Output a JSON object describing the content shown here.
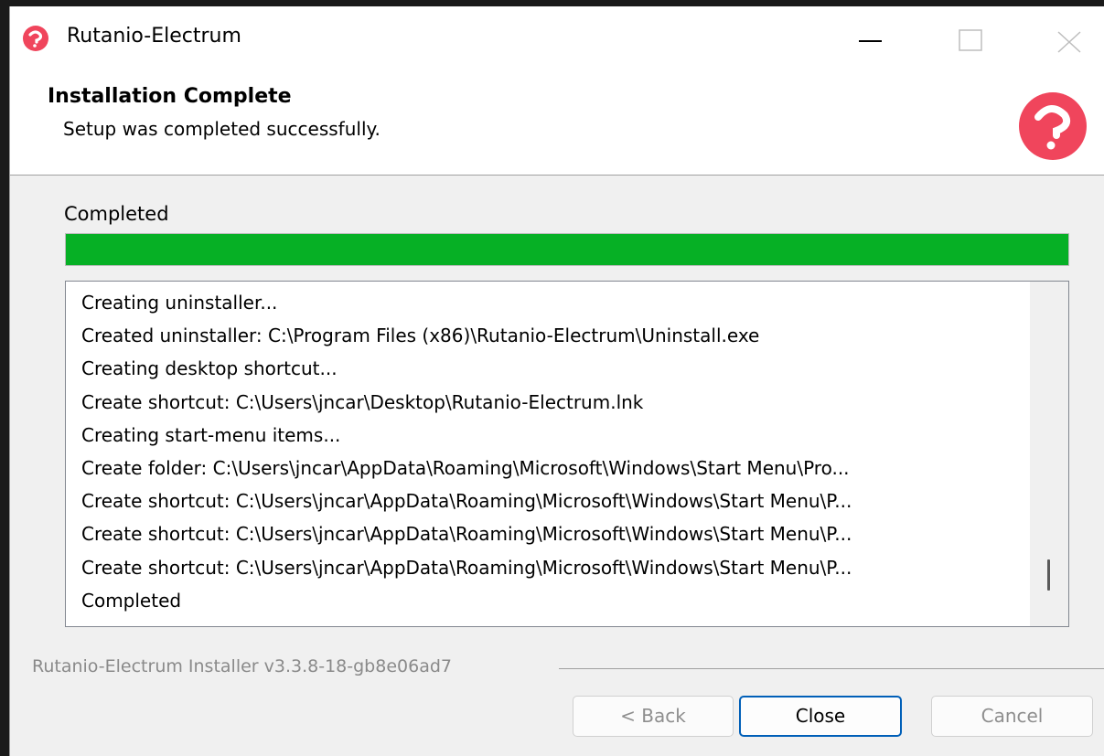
{
  "window": {
    "title": "Rutanio-Electrum",
    "controls": {
      "minimize": "minimize-icon",
      "maximize": "maximize-icon",
      "close": "close-icon"
    }
  },
  "header": {
    "title": "Installation Complete",
    "subtitle": "Setup was completed successfully.",
    "logo": "rutanio-logo-icon"
  },
  "status": {
    "label": "Completed",
    "progress": 1.0
  },
  "log": {
    "lines": [
      "Creating uninstaller...",
      "Created uninstaller: C:\\Program Files (x86)\\Rutanio-Electrum\\Uninstall.exe",
      "Creating desktop shortcut...",
      "Create shortcut: C:\\Users\\jncar\\Desktop\\Rutanio-Electrum.lnk",
      "Creating start-menu items...",
      "Create folder: C:\\Users\\jncar\\AppData\\Roaming\\Microsoft\\Windows\\Start Menu\\Pro...",
      "Create shortcut: C:\\Users\\jncar\\AppData\\Roaming\\Microsoft\\Windows\\Start Menu\\P...",
      "Create shortcut: C:\\Users\\jncar\\AppData\\Roaming\\Microsoft\\Windows\\Start Menu\\P...",
      "Create shortcut: C:\\Users\\jncar\\AppData\\Roaming\\Microsoft\\Windows\\Start Menu\\P...",
      "Completed"
    ]
  },
  "footer": {
    "branding": "Rutanio-Electrum Installer v3.3.8-18-gb8e06ad7",
    "buttons": {
      "back": "< Back",
      "close": "Close",
      "cancel": "Cancel"
    }
  },
  "colors": {
    "progress_fill": "#06b025",
    "brand": "#f0455c",
    "focus_border": "#005fb8"
  }
}
